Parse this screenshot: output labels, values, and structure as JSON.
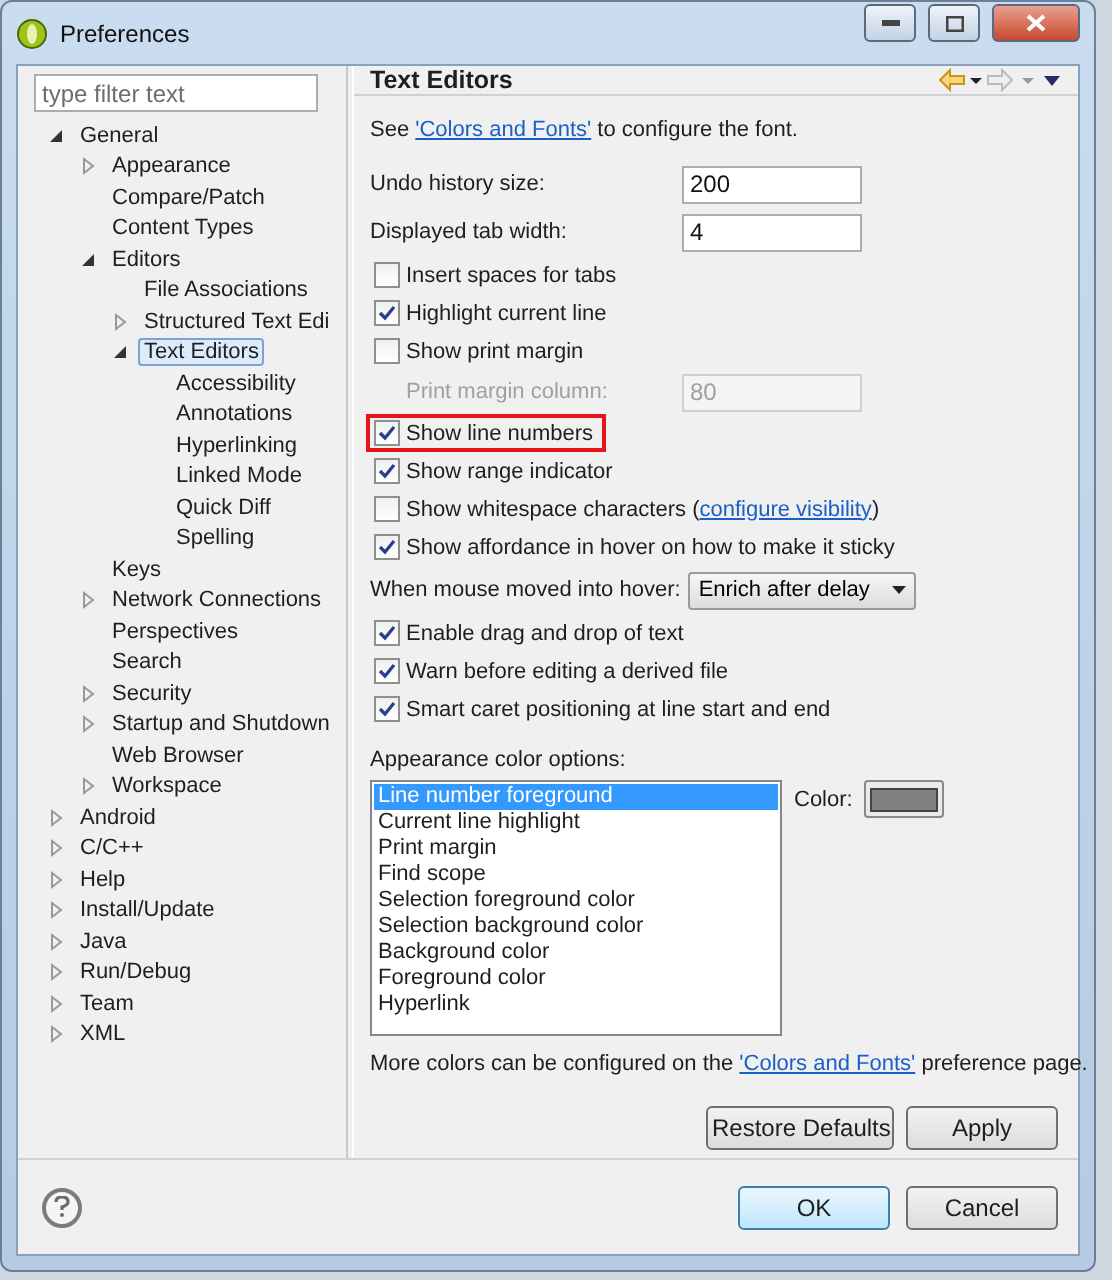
{
  "window": {
    "title": "Preferences"
  },
  "filter": {
    "placeholder": "type filter text"
  },
  "tree": [
    {
      "label": "General",
      "expanded": true,
      "selected": false,
      "children": [
        {
          "label": "Appearance",
          "expanded": false,
          "selected": false
        },
        {
          "label": "Compare/Patch",
          "selected": false
        },
        {
          "label": "Content Types",
          "selected": false
        },
        {
          "label": "Editors",
          "expanded": true,
          "selected": false,
          "children": [
            {
              "label": "File Associations",
              "selected": false
            },
            {
              "label": "Structured Text Edi",
              "expanded": false,
              "selected": false
            },
            {
              "label": "Text Editors",
              "expanded": true,
              "selected": true,
              "children": [
                {
                  "label": "Accessibility",
                  "selected": false
                },
                {
                  "label": "Annotations",
                  "selected": false
                },
                {
                  "label": "Hyperlinking",
                  "selected": false
                },
                {
                  "label": "Linked Mode",
                  "selected": false
                },
                {
                  "label": "Quick Diff",
                  "selected": false
                },
                {
                  "label": "Spelling",
                  "selected": false
                }
              ]
            }
          ]
        },
        {
          "label": "Keys",
          "selected": false
        },
        {
          "label": "Network Connections",
          "expanded": false,
          "selected": false
        },
        {
          "label": "Perspectives",
          "selected": false
        },
        {
          "label": "Search",
          "selected": false
        },
        {
          "label": "Security",
          "expanded": false,
          "selected": false
        },
        {
          "label": "Startup and Shutdown",
          "expanded": false,
          "selected": false
        },
        {
          "label": "Web Browser",
          "selected": false
        },
        {
          "label": "Workspace",
          "expanded": false,
          "selected": false
        }
      ]
    },
    {
      "label": "Android",
      "expanded": false,
      "selected": false
    },
    {
      "label": "C/C++",
      "expanded": false,
      "selected": false
    },
    {
      "label": "Help",
      "expanded": false,
      "selected": false
    },
    {
      "label": "Install/Update",
      "expanded": false,
      "selected": false
    },
    {
      "label": "Java",
      "expanded": false,
      "selected": false
    },
    {
      "label": "Run/Debug",
      "expanded": false,
      "selected": false
    },
    {
      "label": "Team",
      "expanded": false,
      "selected": false
    },
    {
      "label": "XML",
      "expanded": false,
      "selected": false
    }
  ],
  "page": {
    "title": "Text Editors",
    "intro": {
      "before": "See ",
      "link": "'Colors and Fonts'",
      "after": " to configure the font."
    },
    "options": [
      {
        "kind": "field",
        "label": "Undo history size:",
        "value": "200",
        "disabled": false
      },
      {
        "kind": "field",
        "label": "Displayed tab width:",
        "value": "4",
        "disabled": false
      },
      {
        "kind": "checkbox",
        "label": "Insert spaces for tabs",
        "checked": false,
        "highlighted": false
      },
      {
        "kind": "checkbox",
        "label": "Highlight current line",
        "checked": true,
        "highlighted": false
      },
      {
        "kind": "checkbox",
        "label": "Show print margin",
        "checked": false,
        "highlighted": false
      },
      {
        "kind": "field",
        "label": "Print margin column:",
        "value": "80",
        "disabled": true
      },
      {
        "kind": "checkbox",
        "label": "Show line numbers",
        "checked": true,
        "highlighted": true
      },
      {
        "kind": "checkbox",
        "label": "Show range indicator",
        "checked": true,
        "highlighted": false
      },
      {
        "kind": "checkbox",
        "label": "Show whitespace characters (",
        "link": "configure visibility",
        "after": ")",
        "checked": false,
        "highlighted": false
      },
      {
        "kind": "checkbox",
        "label": "Show affordance in hover on how to make it sticky",
        "checked": true,
        "highlighted": false
      },
      {
        "kind": "dropdown",
        "label": "When mouse moved into hover:",
        "value": "Enrich after delay"
      },
      {
        "kind": "checkbox",
        "label": "Enable drag and drop of text",
        "checked": true,
        "highlighted": false
      },
      {
        "kind": "checkbox",
        "label": "Warn before editing a derived file",
        "checked": true,
        "highlighted": false
      },
      {
        "kind": "checkbox",
        "label": "Smart caret positioning at line start and end",
        "checked": true,
        "highlighted": false
      }
    ],
    "appearance": {
      "label": "Appearance color options:",
      "items": [
        {
          "label": "Line number foreground",
          "selected": true
        },
        {
          "label": "Current line highlight",
          "selected": false
        },
        {
          "label": "Print margin",
          "selected": false
        },
        {
          "label": "Find scope",
          "selected": false
        },
        {
          "label": "Selection foreground color",
          "selected": false
        },
        {
          "label": "Selection background color",
          "selected": false
        },
        {
          "label": "Background color",
          "selected": false
        },
        {
          "label": "Foreground color",
          "selected": false
        },
        {
          "label": "Hyperlink",
          "selected": false
        }
      ],
      "color_label": "Color:"
    },
    "footer_note": {
      "before": "More colors can be configured on the ",
      "link": "'Colors and Fonts'",
      "after": " preference page."
    },
    "buttons": [
      "Restore Defaults",
      "Apply"
    ]
  },
  "dialog_buttons": [
    "OK",
    "Cancel"
  ]
}
